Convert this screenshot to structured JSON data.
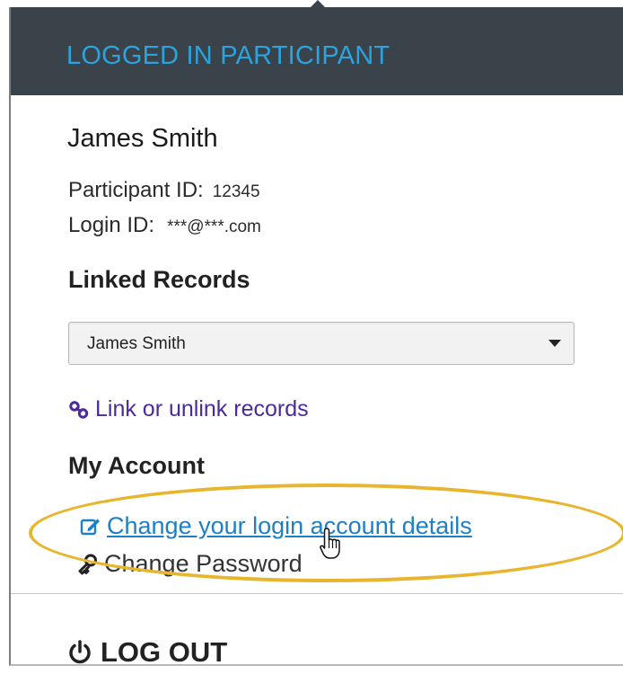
{
  "header": {
    "title": "LOGGED IN PARTICIPANT"
  },
  "participant": {
    "name": "James Smith",
    "participant_id_label": "Participant ID:",
    "participant_id_value": "12345",
    "login_id_label": "Login ID:",
    "login_id_value": "***@***.com"
  },
  "linked_records": {
    "title": "Linked Records",
    "selected_value": "James Smith",
    "link_label": "Link or unlink records"
  },
  "my_account": {
    "title": "My Account",
    "change_login_label": "Change your login account details",
    "change_password_label": "Change Password"
  },
  "logout": {
    "label": "LOG OUT"
  },
  "colors": {
    "header_bg": "#3a424a",
    "header_text": "#2ba3df",
    "link_blue": "#1e7fc4",
    "link_purple": "#4b2a9c",
    "highlight": "#e8b52e"
  },
  "icons": {
    "link": "link-icon",
    "edit": "edit-icon",
    "key": "key-icon",
    "power": "power-icon",
    "dropdown": "chevron-down-icon",
    "cursor": "hand-cursor-icon"
  }
}
